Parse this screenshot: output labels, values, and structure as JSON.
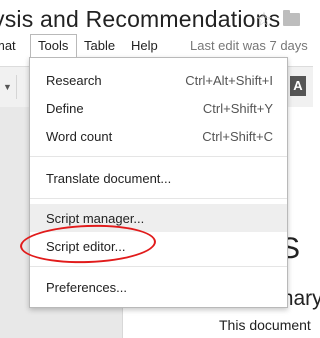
{
  "title": {
    "text": "ysis and Recommendations"
  },
  "menubar": {
    "format": "mat",
    "tools": "Tools",
    "table": "Table",
    "help": "Help",
    "last_edit": "Last edit was 7 days"
  },
  "toolbar": {
    "text_color_label": "A"
  },
  "document": {
    "heading": "d S",
    "subheading": "mary",
    "body": "This document"
  },
  "tools_menu": {
    "items": [
      {
        "label": "Research",
        "shortcut": "Ctrl+Alt+Shift+I"
      },
      {
        "label": "Define",
        "shortcut": "Ctrl+Shift+Y"
      },
      {
        "label": "Word count",
        "shortcut": "Ctrl+Shift+C"
      },
      {
        "label": "Translate document...",
        "shortcut": ""
      },
      {
        "label": "Script manager...",
        "shortcut": ""
      },
      {
        "label": "Script editor...",
        "shortcut": ""
      },
      {
        "label": "Preferences...",
        "shortcut": ""
      }
    ],
    "hovered_item": "Script manager...",
    "annotated_item": "Script editor..."
  },
  "colors": {
    "annotation": "#e11b1b",
    "hover": "#eeeeee"
  }
}
